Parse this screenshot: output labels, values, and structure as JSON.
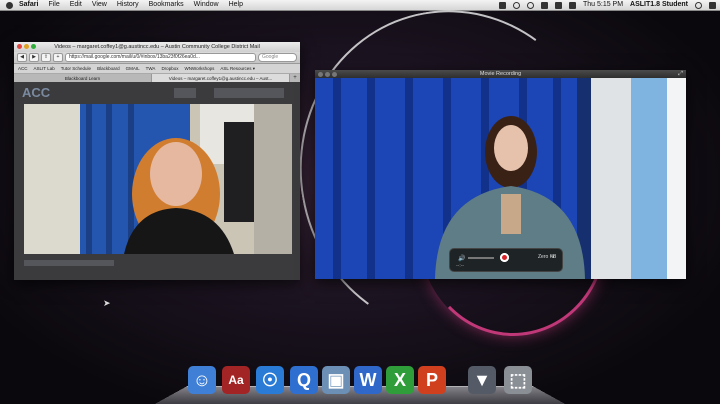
{
  "menubar": {
    "app": "Safari",
    "items": [
      "File",
      "Edit",
      "View",
      "History",
      "Bookmarks",
      "Window",
      "Help"
    ],
    "clock": "Thu 5:15 PM",
    "user": "ASLIT1.8 Student"
  },
  "safari": {
    "window_title": "Videos – margaret.coffey1@g.austincc.edu – Austin Community College District Mail",
    "url": "https://mail.google.com/mail/u/0/#inbox/13ba23f0f26ea0d...",
    "search_placeholder": "Google",
    "bookmarks": [
      "ACC",
      "ASLIT Lab",
      "Tutor Schedule",
      "Blackboard",
      "GMAIL",
      "TWA",
      "Dropbox",
      "WNWorkshops",
      "ASL Resources ▾"
    ],
    "tabs": [
      "Blackboard Learn",
      "Videos – margaret.coffey1@g.austincc.edu – Aust..."
    ],
    "tab_plus": "+",
    "logo": "ACC"
  },
  "recorder": {
    "window_title": "Movie Recording",
    "hud": {
      "size": "Zero KB",
      "time": "--:--",
      "volume_icon": "speaker-icon",
      "record_icon": "record-icon"
    }
  },
  "dock": {
    "items": [
      {
        "name": "finder",
        "glyph": "☺",
        "color": "#3f7fd6"
      },
      {
        "name": "dictionary",
        "glyph": "Aa",
        "color": "#a32424"
      },
      {
        "name": "safari",
        "glyph": "☉",
        "color": "#2a7bd6"
      },
      {
        "name": "quicktime",
        "glyph": "Q",
        "color": "#2f6fd0"
      },
      {
        "name": "preview",
        "glyph": "▣",
        "color": "#6b8fb5"
      },
      {
        "name": "word",
        "glyph": "W",
        "color": "#2f68c9"
      },
      {
        "name": "excel",
        "glyph": "X",
        "color": "#2f9e3a"
      },
      {
        "name": "powerpoint",
        "glyph": "P",
        "color": "#d0401f"
      },
      {
        "name": "downloads",
        "glyph": "▼",
        "color": "#555b66"
      },
      {
        "name": "trash",
        "glyph": "⬚",
        "color": "#8a8e95"
      }
    ]
  },
  "colors": {
    "accent_pink": "#e0408a",
    "record_red": "#d8232a",
    "curtain_blue": "#1a3fa8"
  }
}
